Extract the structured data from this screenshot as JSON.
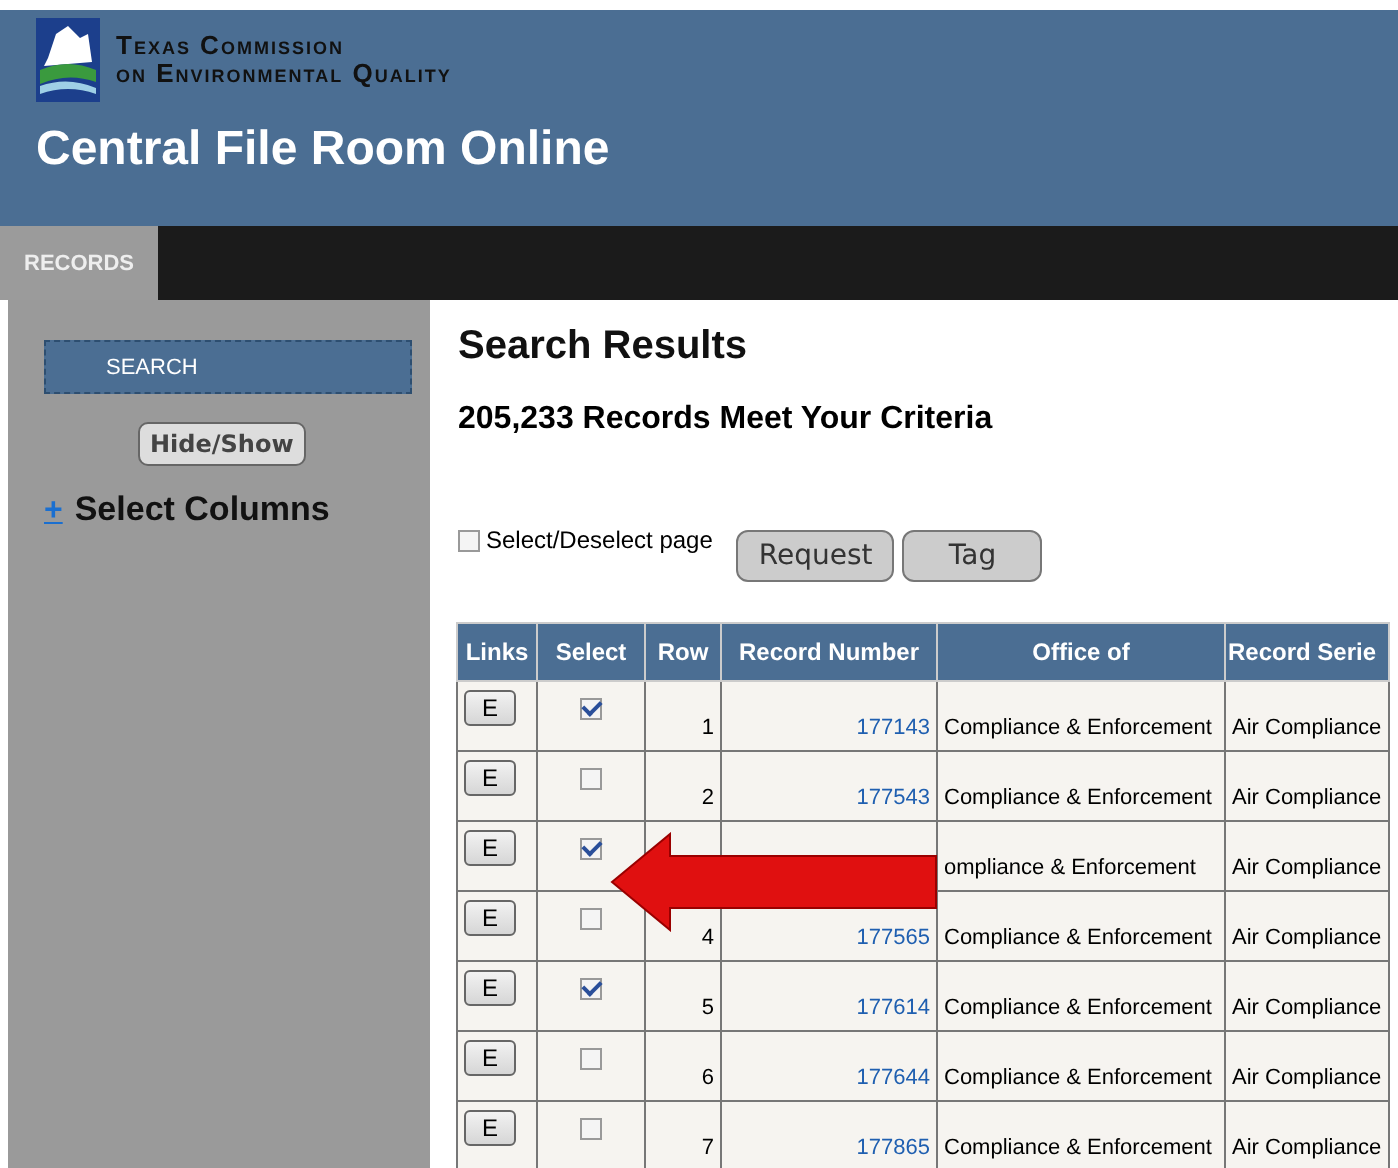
{
  "header": {
    "org_line_1": "Texas Commission",
    "org_line_2": "on Environmental Quality",
    "app_title": "Central File Room Online"
  },
  "nav": {
    "tabs": [
      {
        "label": "RECORDS",
        "selected": true
      }
    ]
  },
  "sidebar": {
    "search_button": "SEARCH",
    "hide_show_button": "Hide/Show",
    "expand_symbol": "+",
    "select_columns": "Select Columns"
  },
  "results": {
    "title": "Search Results",
    "count": "205,233 Records Meet Your Criteria",
    "select_page": {
      "label": "Select/Deselect page",
      "checked": false
    },
    "buttons": [
      "Request",
      "Tag"
    ]
  },
  "table": {
    "columns": [
      "Links",
      "Select",
      "Row",
      "Record Number",
      "Office of",
      "Record Serie"
    ],
    "rows": [
      {
        "link": "E",
        "selected": true,
        "row": "1",
        "record_number": "177143",
        "office": "Compliance & Enforcement",
        "series": "Air Compliance"
      },
      {
        "link": "E",
        "selected": false,
        "row": "2",
        "record_number": "177543",
        "office": "Compliance & Enforcement",
        "series": "Air Compliance"
      },
      {
        "link": "E",
        "selected": true,
        "office": "ompliance & Enforcement",
        "series": "Air Compliance"
      },
      {
        "link": "E",
        "selected": false,
        "row": "4",
        "record_number": "177565",
        "office": "Compliance & Enforcement",
        "series": "Air Compliance"
      },
      {
        "link": "E",
        "selected": true,
        "row": "5",
        "record_number": "177614",
        "office": "Compliance & Enforcement",
        "series": "Air Compliance"
      },
      {
        "link": "E",
        "selected": false,
        "row": "6",
        "record_number": "177644",
        "office": "Compliance & Enforcement",
        "series": "Air Compliance"
      },
      {
        "link": "E",
        "selected": false,
        "row": "7",
        "record_number": "177865",
        "office": "Compliance & Enforcement",
        "series": "Air Compliance"
      }
    ]
  }
}
